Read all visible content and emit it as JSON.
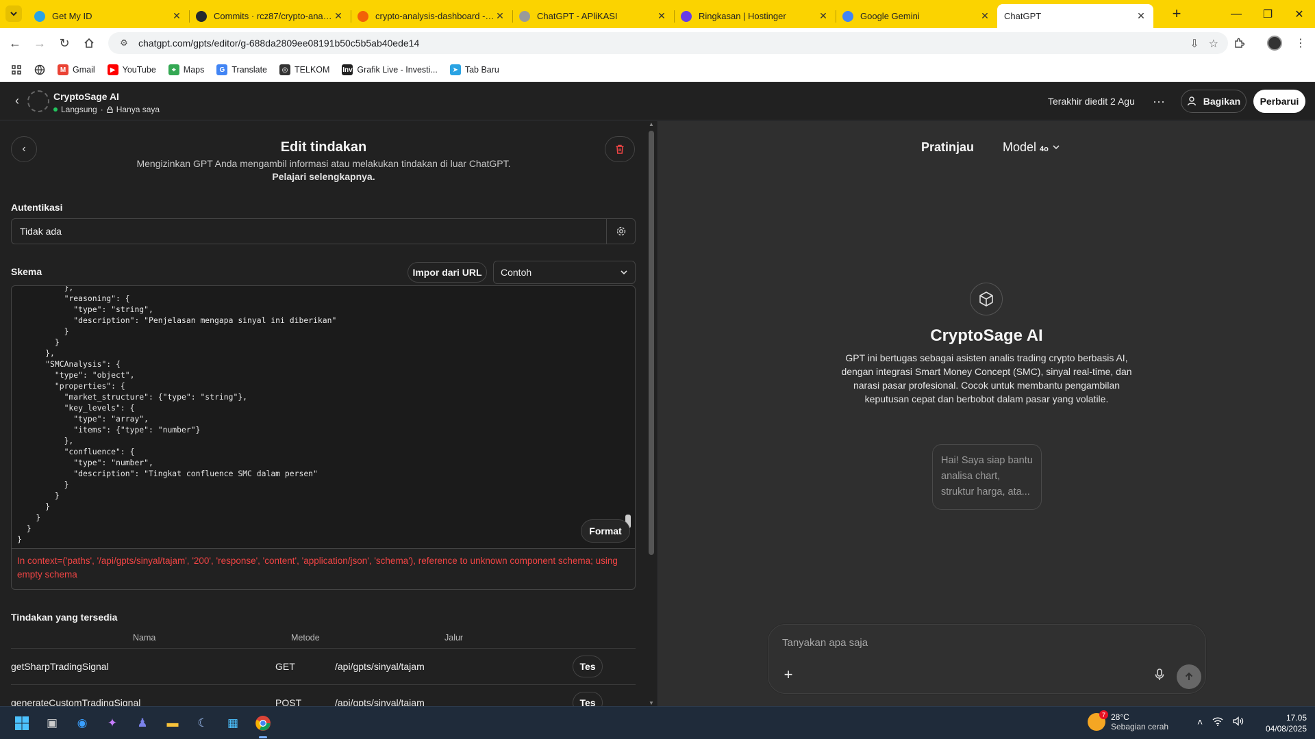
{
  "browser": {
    "tabs": [
      {
        "title": "Get My ID",
        "icon": "telegram-icon",
        "color": "#2aa3e3"
      },
      {
        "title": "Commits · rcz87/crypto-analysis",
        "icon": "github-icon",
        "color": "#24292e"
      },
      {
        "title": "crypto-analysis-dashboard - Re",
        "icon": "replit-icon",
        "color": "#f26207"
      },
      {
        "title": "ChatGPT - APliKASI",
        "icon": "chatgpt-icon",
        "color": "#9a9a9a"
      },
      {
        "title": "Ringkasan | Hostinger",
        "icon": "hostinger-icon",
        "color": "#673de6"
      },
      {
        "title": "Google Gemini",
        "icon": "gemini-icon",
        "color": "#4285f4"
      },
      {
        "title": "ChatGPT",
        "icon": "chatgpt-icon",
        "color": "#ffffff"
      }
    ],
    "url": "chatgpt.com/gpts/editor/g-688da2809ee08191b50c5b5ab40ede14",
    "bookmarks": [
      {
        "label": "Gmail",
        "color": "#ea4335",
        "glyph": "M"
      },
      {
        "label": "YouTube",
        "color": "#ff0000",
        "glyph": "▶"
      },
      {
        "label": "Maps",
        "color": "#34a853",
        "glyph": "⌖"
      },
      {
        "label": "Translate",
        "color": "#4285f4",
        "glyph": "G"
      },
      {
        "label": "TELKOM",
        "color": "#333333",
        "glyph": "◎"
      },
      {
        "label": "Grafik Live - Investi...",
        "color": "#222222",
        "glyph": "Inv"
      },
      {
        "label": "Tab Baru",
        "color": "#2aa3e3",
        "glyph": "➤"
      }
    ]
  },
  "header": {
    "gpt_name": "CryptoSage AI",
    "status": "Langsung",
    "visibility": "Hanya saya",
    "last_edited": "Terakhir diedit 2 Agu",
    "share_label": "Bagikan",
    "update_label": "Perbarui"
  },
  "editor": {
    "title": "Edit tindakan",
    "subtitle": "Mengizinkan GPT Anda mengambil informasi atau melakukan tindakan di luar ChatGPT.",
    "learn_more": "Pelajari selengkapnya.",
    "auth_label": "Autentikasi",
    "auth_value": "Tidak ada",
    "schema_label": "Skema",
    "import_label": "Impor dari URL",
    "example_select": "Contoh",
    "schema_code": "          },\n          \"reasoning\": {\n            \"type\": \"string\",\n            \"description\": \"Penjelasan mengapa sinyal ini diberikan\"\n          }\n        }\n      },\n      \"SMCAnalysis\": {\n        \"type\": \"object\",\n        \"properties\": {\n          \"market_structure\": {\"type\": \"string\"},\n          \"key_levels\": {\n            \"type\": \"array\",\n            \"items\": {\"type\": \"number\"}\n          },\n          \"confluence\": {\n            \"type\": \"number\",\n            \"description\": \"Tingkat confluence SMC dalam persen\"\n          }\n        }\n      }\n    }\n  }\n}",
    "format_label": "Format",
    "error": "In context=('paths', '/api/gpts/sinyal/tajam', '200', 'response', 'content', 'application/json', 'schema'), reference to unknown component schema; using empty schema",
    "actions_label": "Tindakan yang tersedia",
    "columns": {
      "name": "Nama",
      "method": "Metode",
      "path": "Jalur"
    },
    "actions": [
      {
        "name": "getSharpTradingSignal",
        "method": "GET",
        "path": "/api/gpts/sinyal/tajam",
        "test": "Tes"
      },
      {
        "name": "generateCustomTradingSignal",
        "method": "POST",
        "path": "/api/gpts/sinyal/tajam",
        "test": "Tes"
      }
    ]
  },
  "preview": {
    "tab_label": "Pratinjau",
    "model_label": "Model",
    "model_version": "4o",
    "gpt_title": "CryptoSage AI",
    "description": "GPT ini bertugas sebagai asisten analis trading crypto berbasis AI, dengan integrasi Smart Money Concept (SMC), sinyal real-time, dan narasi pasar profesional. Cocok untuk membantu pengambilan keputusan cepat dan berbobot dalam pasar yang volatile.",
    "starter": "Hai! Saya siap bantu analisa chart, struktur harga, ata...",
    "composer_placeholder": "Tanyakan apa saja"
  },
  "taskbar": {
    "temperature": "28°C",
    "weather": "Sebagian cerah",
    "weather_badge": "7",
    "time": "17.05",
    "date": "04/08/2025"
  }
}
